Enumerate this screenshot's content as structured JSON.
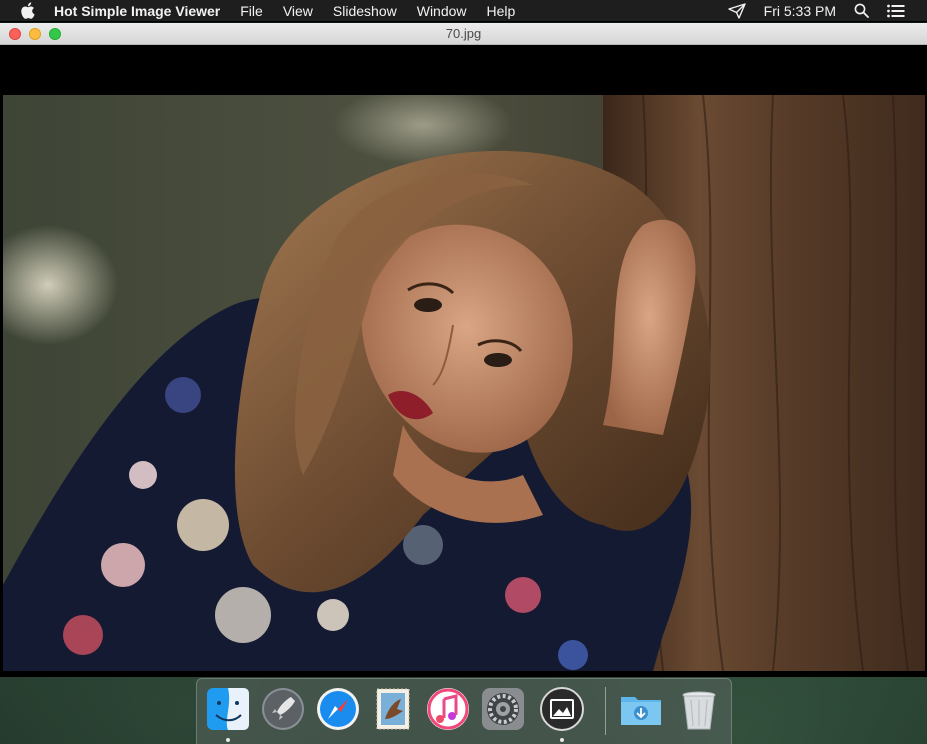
{
  "menubar": {
    "apple_icon": "apple-icon",
    "app_name": "Hot Simple Image Viewer",
    "items": [
      "File",
      "View",
      "Slideshow",
      "Window",
      "Help"
    ],
    "status_icon": "paper-plane-icon",
    "clock": "Fri 5:33 PM",
    "search_icon": "search-icon",
    "notifications_icon": "list-icon"
  },
  "window": {
    "title": "70.jpg",
    "image": {
      "description_icon": "portrait-photo",
      "filename": "70.jpg"
    }
  },
  "dock": {
    "items": [
      {
        "name": "Finder",
        "icon": "finder-icon",
        "running": true
      },
      {
        "name": "Launchpad",
        "icon": "rocket-icon",
        "running": false
      },
      {
        "name": "Safari",
        "icon": "compass-icon",
        "running": false
      },
      {
        "name": "Mail",
        "icon": "stamp-icon",
        "running": false
      },
      {
        "name": "iTunes",
        "icon": "music-note-icon",
        "running": false
      },
      {
        "name": "System Preferences",
        "icon": "gear-icon",
        "running": false
      },
      {
        "name": "Hot Simple Image Viewer",
        "icon": "image-icon",
        "running": true
      },
      {
        "name": "Downloads",
        "icon": "downloads-folder-icon",
        "running": false
      },
      {
        "name": "Trash",
        "icon": "trash-icon",
        "running": false
      }
    ]
  },
  "colors": {
    "menubar_bg": "#1e1e1e",
    "close": "#fc605b",
    "minimize": "#fdbc40",
    "maximize": "#34c84a"
  }
}
